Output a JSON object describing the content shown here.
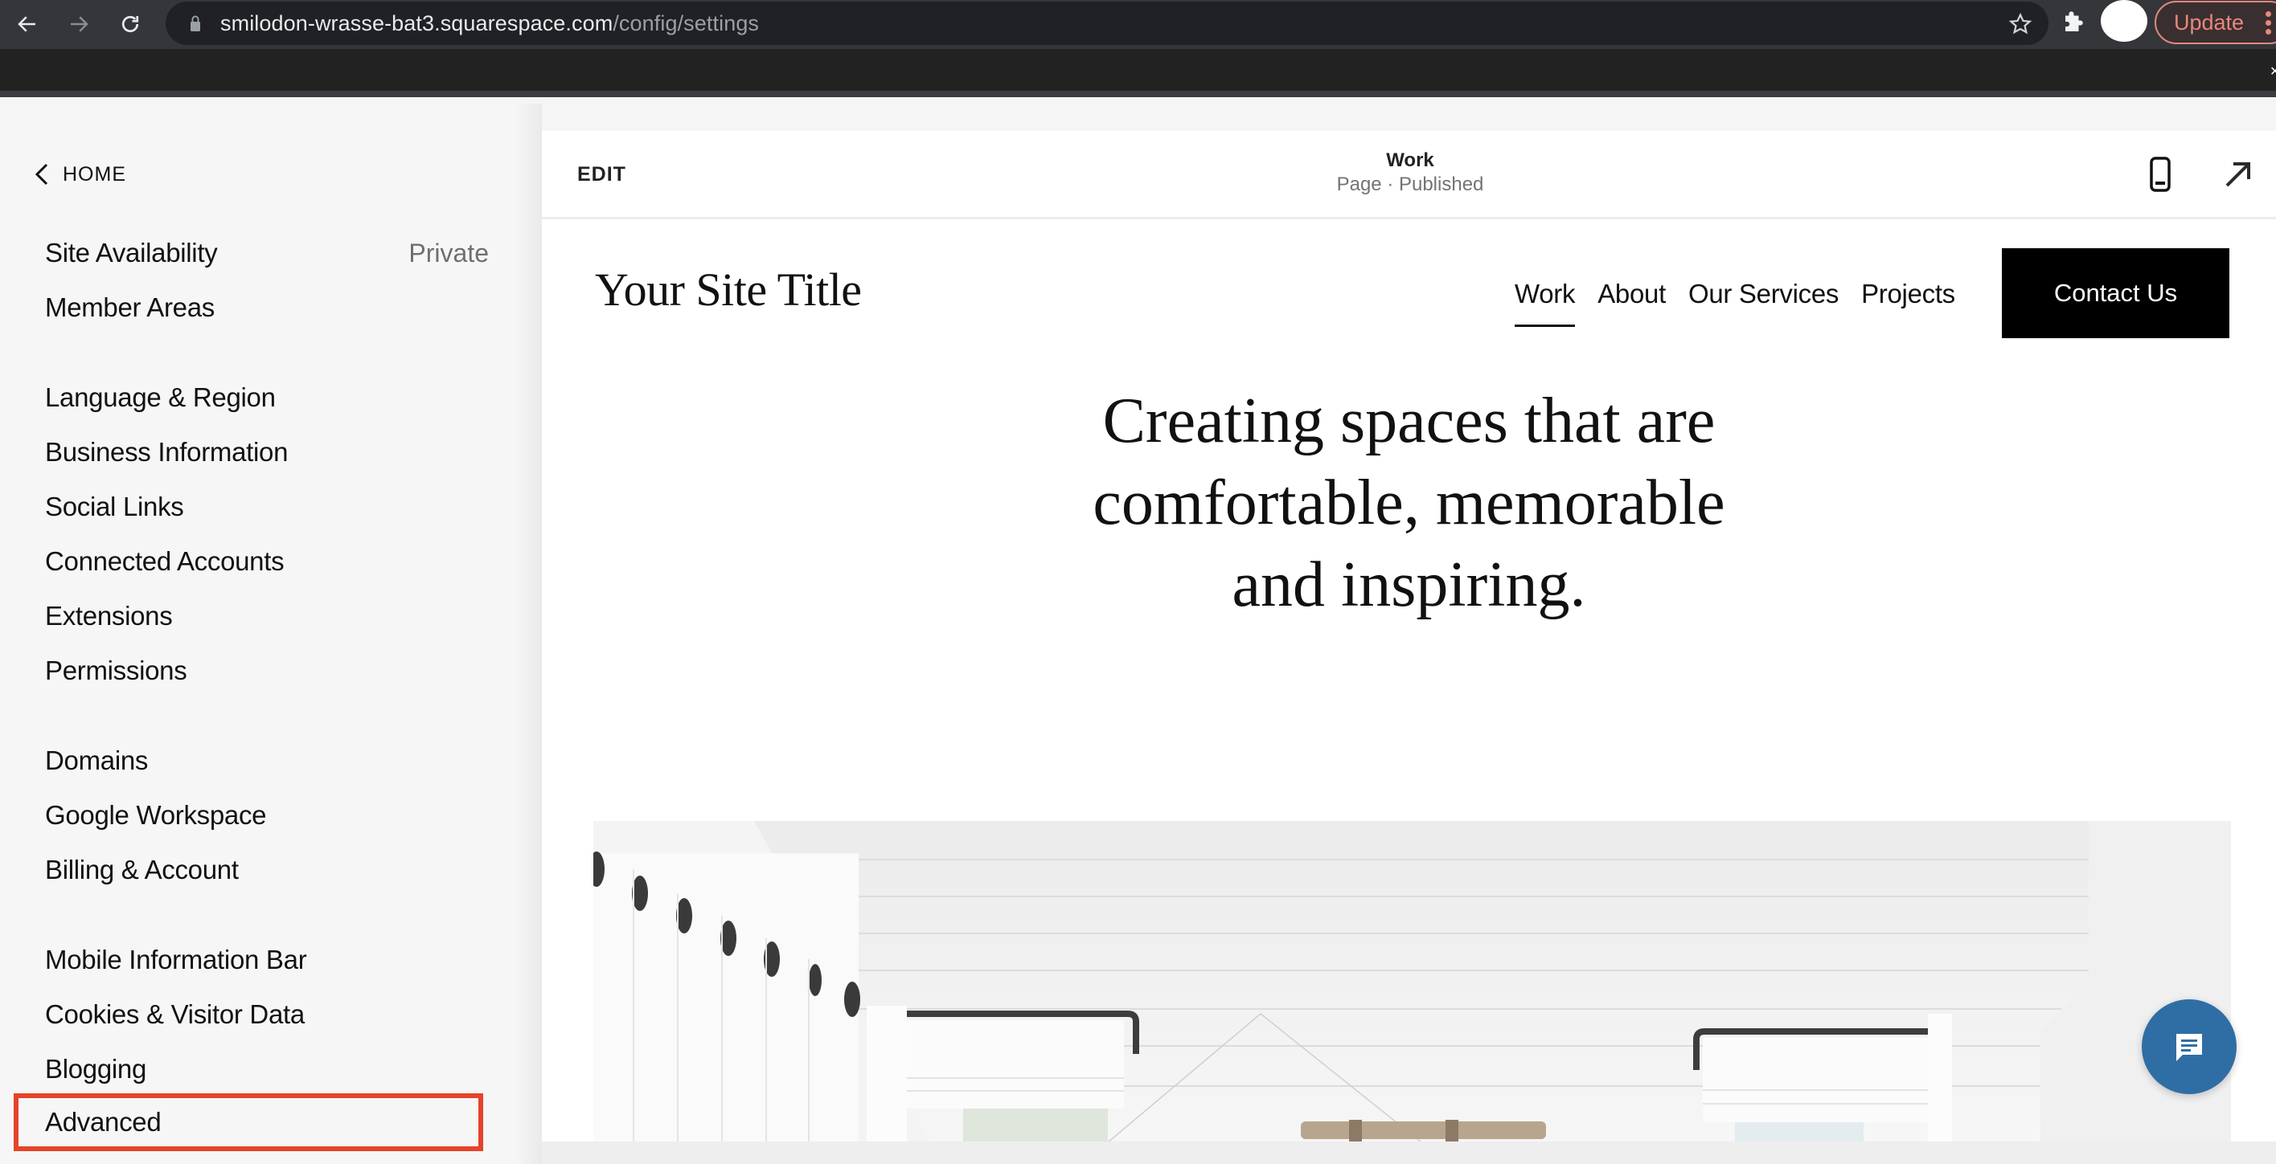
{
  "browser": {
    "url_host": "smilodon-wrasse-bat3.squarespace.com",
    "url_path": "/config/settings",
    "update_label": "Update",
    "icons": {
      "back": "arrow-left-icon",
      "forward": "arrow-right-icon",
      "reload": "reload-icon",
      "lock": "lock-icon",
      "bookmark": "star-icon",
      "extensions": "puzzle-icon",
      "profile": "avatar",
      "menu": "kebab-menu-icon"
    }
  },
  "sidebar": {
    "home_label": "HOME",
    "items": [
      {
        "label": "Site Availability",
        "value": "Private"
      },
      {
        "label": "Member Areas"
      },
      {
        "label": "Language & Region"
      },
      {
        "label": "Business Information"
      },
      {
        "label": "Social Links"
      },
      {
        "label": "Connected Accounts"
      },
      {
        "label": "Extensions"
      },
      {
        "label": "Permissions"
      },
      {
        "label": "Domains"
      },
      {
        "label": "Google Workspace"
      },
      {
        "label": "Billing & Account"
      },
      {
        "label": "Mobile Information Bar"
      },
      {
        "label": "Cookies & Visitor Data"
      },
      {
        "label": "Blogging"
      },
      {
        "label": "Advanced",
        "highlighted": true
      }
    ],
    "highlight_color": "#e5432a"
  },
  "preview": {
    "edit_label": "EDIT",
    "page_name": "Work",
    "page_status": "Page · Published",
    "site_title": "Your Site Title",
    "nav": [
      {
        "label": "Work",
        "active": true
      },
      {
        "label": "About"
      },
      {
        "label": "Our Services"
      },
      {
        "label": "Projects"
      }
    ],
    "cta_label": "Contact Us",
    "hero_lines": [
      "Creating spaces that are",
      "comfortable, memorable",
      "and inspiring."
    ],
    "image_description": "White curtains with dark grommet rods and roman shades under a white shiplap sloped ceiling",
    "chat_color": "#2f6ea4"
  }
}
